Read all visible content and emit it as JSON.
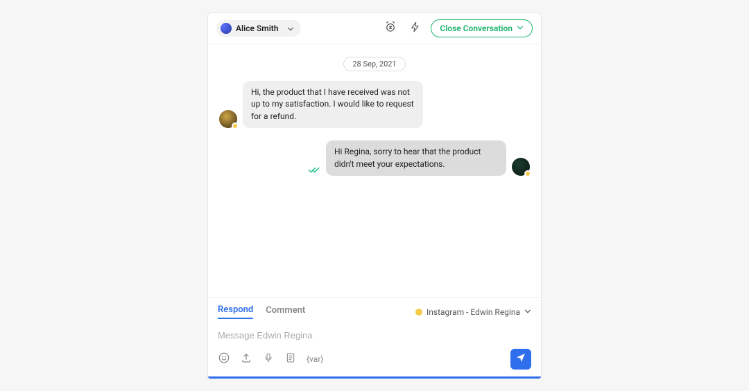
{
  "header": {
    "assignee_name": "Alice Smith",
    "close_label": "Close Conversation"
  },
  "chat": {
    "date_label": "28 Sep, 2021",
    "messages": [
      {
        "side": "left",
        "text": "Hi, the product that I have received was not up to my satisfaction. I would like to request for a refund."
      },
      {
        "side": "right",
        "text": "Hi Regina, sorry to hear that the product didn't meet your expectations."
      }
    ]
  },
  "composer": {
    "tabs": {
      "respond": "Respond",
      "comment": "Comment"
    },
    "channel_label": "Instagram - Edwin Regina",
    "placeholder": "Message Edwin Regina",
    "var_token": "{var}"
  }
}
